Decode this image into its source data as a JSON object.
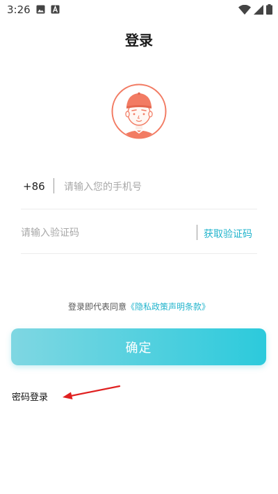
{
  "status_bar": {
    "time": "3:26",
    "left_icons": [
      "image-icon",
      "a-icon"
    ],
    "right_icons": [
      "wifi-icon",
      "signal-icon",
      "battery-icon"
    ]
  },
  "header": {
    "title": "登录"
  },
  "avatar": {
    "icon": "avatar-icon"
  },
  "phone": {
    "country_code": "+86",
    "placeholder": "请输入您的手机号"
  },
  "verification": {
    "placeholder": "请输入验证码",
    "get_code_label": "获取验证码"
  },
  "agreement": {
    "prefix": "登录即代表同意",
    "link": "《隐私政策声明条款》"
  },
  "confirm_button": {
    "label": "确定"
  },
  "password_login": {
    "label": "密码登录"
  },
  "colors": {
    "accent": "#22b4cc",
    "button_start": "#7fd7e2",
    "button_end": "#2ccadc",
    "arrow": "#e02020",
    "avatar": "#f27b63"
  }
}
